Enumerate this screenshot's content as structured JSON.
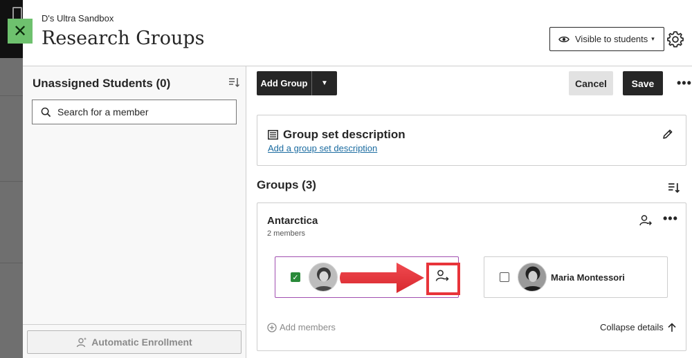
{
  "window": {
    "breadcrumb": "D's Ultra Sandbox",
    "title": "Research Groups",
    "close_label": "✕",
    "visibility_label": "Visible to students",
    "visibility_caret": "▾"
  },
  "left_panel": {
    "title": "Unassigned Students (0)",
    "search_placeholder": "Search for a member",
    "auto_enroll_label": "Automatic Enrollment"
  },
  "toolbar": {
    "add_group_label": "Add Group",
    "add_group_dropdown_glyph": "▼",
    "cancel_label": "Cancel",
    "save_label": "Save",
    "more_glyph": "•••"
  },
  "description": {
    "title": "Group set description",
    "link": "Add a group set description"
  },
  "groups": {
    "title": "Groups (3)",
    "items": [
      {
        "name": "Antarctica",
        "count": "2 members",
        "members": [
          {
            "name": "",
            "checked": true,
            "checkmark": "✓"
          },
          {
            "name": "Maria Montessori",
            "checked": false,
            "checkmark": ""
          }
        ],
        "more_glyph": "•••",
        "add_members_label": "Add members",
        "collapse_label": "Collapse details"
      }
    ]
  },
  "colors": {
    "accent_green": "#6ec16e",
    "checkbox_green": "#2a8a3a",
    "selection_purple": "#a04eb0",
    "annotation_red": "#e8343a",
    "link_blue": "#1a6ba0",
    "dark_button": "#262626"
  }
}
